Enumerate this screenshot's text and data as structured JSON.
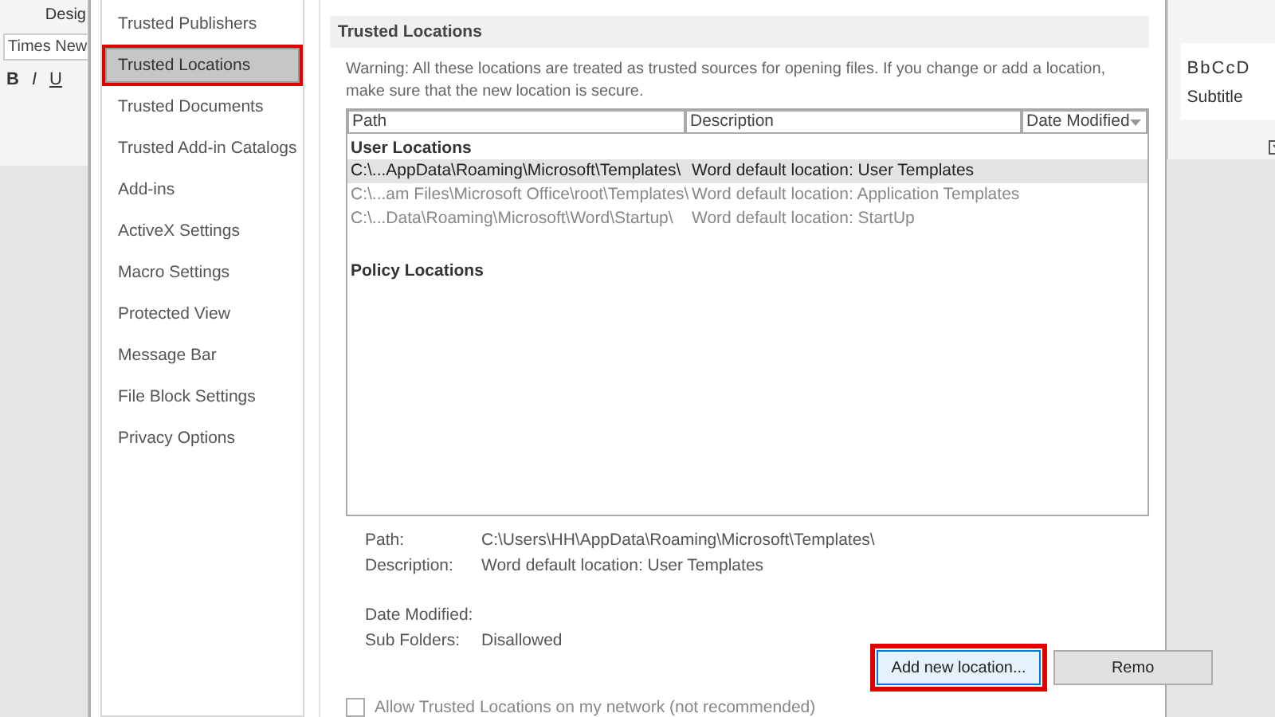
{
  "background_app": {
    "tab_label": "Desig",
    "font_box": "Times New",
    "format_buttons": [
      "B",
      "I",
      "U"
    ],
    "style_preview": "BbCcD",
    "style_name": "Subtitle"
  },
  "sidebar": {
    "items": [
      {
        "label": "Trusted Publishers",
        "selected": false
      },
      {
        "label": "Trusted Locations",
        "selected": true
      },
      {
        "label": "Trusted Documents",
        "selected": false
      },
      {
        "label": "Trusted Add-in Catalogs",
        "selected": false
      },
      {
        "label": "Add-ins",
        "selected": false
      },
      {
        "label": "ActiveX Settings",
        "selected": false
      },
      {
        "label": "Macro Settings",
        "selected": false
      },
      {
        "label": "Protected View",
        "selected": false
      },
      {
        "label": "Message Bar",
        "selected": false
      },
      {
        "label": "File Block Settings",
        "selected": false
      },
      {
        "label": "Privacy Options",
        "selected": false
      }
    ]
  },
  "section_title": "Trusted Locations",
  "warning": "Warning: All these locations are treated as trusted sources for opening files.  If you change or add a location, make sure that the new location is secure.",
  "table": {
    "columns": [
      "Path",
      "Description",
      "Date Modified"
    ],
    "groups": [
      {
        "title": "User Locations",
        "rows": [
          {
            "path": "C:\\...AppData\\Roaming\\Microsoft\\Templates\\",
            "description": "Word default location: User Templates",
            "selected": true
          },
          {
            "path": "C:\\...am Files\\Microsoft Office\\root\\Templates\\",
            "description": "Word default location: Application Templates",
            "selected": false
          },
          {
            "path": "C:\\...Data\\Roaming\\Microsoft\\Word\\Startup\\",
            "description": "Word default location: StartUp",
            "selected": false
          }
        ]
      },
      {
        "title": "Policy Locations"
      }
    ]
  },
  "details": [
    {
      "label": "Path:",
      "value": "C:\\Users\\HH\\AppData\\Roaming\\Microsoft\\Templates\\"
    },
    {
      "label": "Description:",
      "value": "Word default location: User Templates"
    },
    {
      "label": "Date Modified:"
    },
    {
      "label": "Sub Folders:",
      "value": "Disallowed"
    }
  ],
  "buttons": [
    {
      "label": "Add new location...",
      "highlighted": true
    },
    {
      "label": "Remo",
      "highlighted": false
    }
  ],
  "network_checkbox": {
    "label": "Allow Trusted Locations on my network (not recommended)",
    "checked": false
  }
}
